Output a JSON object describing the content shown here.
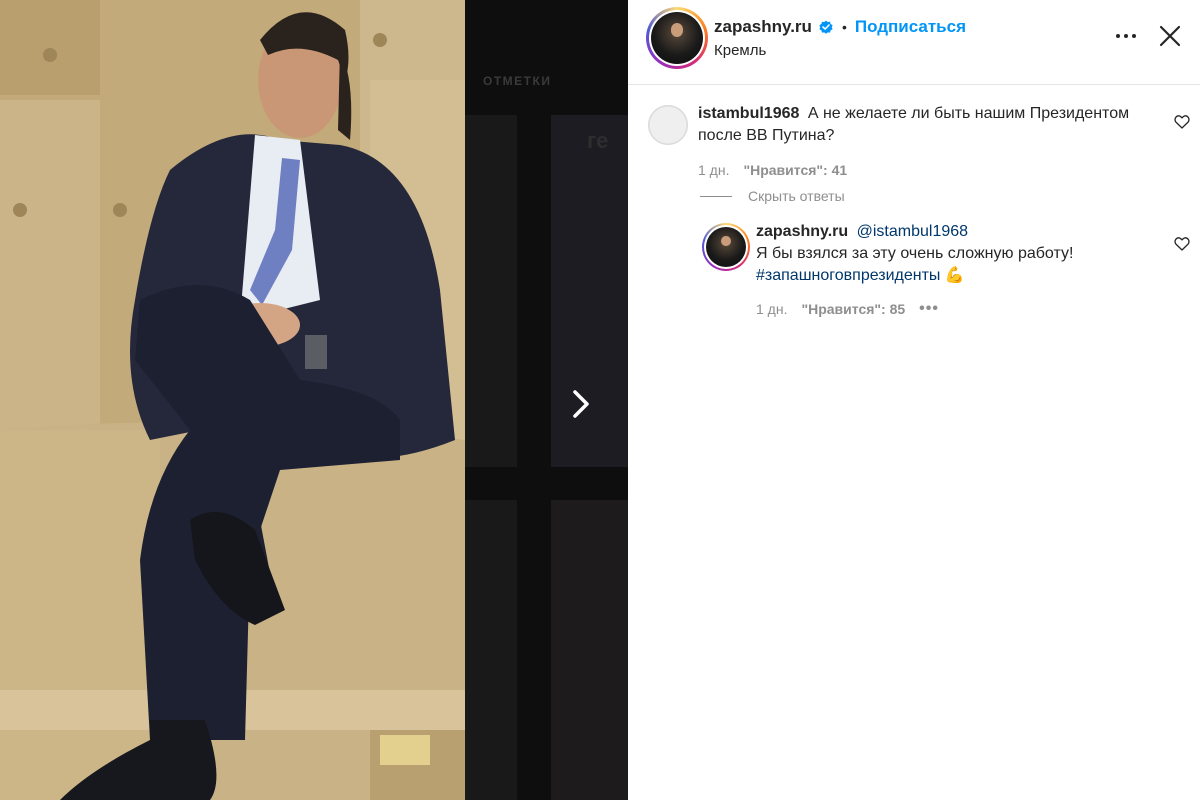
{
  "header": {
    "username": "zapashny.ru",
    "separator": "•",
    "follow_label": "Подписаться",
    "location": "Кремль",
    "verified_color": "#0095f6",
    "follow_color": "#0095f6"
  },
  "backdrop": {
    "tab_label": "ОТМЕТКИ",
    "tile_text": "ге"
  },
  "comments": [
    {
      "username": "istambul1968",
      "text_line1": "А не желаете ли быть нашим Президентом",
      "text_line2": "после ВВ Путина?",
      "age": "1 дн.",
      "likes": "\"Нравится\": 41"
    }
  ],
  "hide_replies_label": "Скрыть ответы",
  "reply": {
    "username": "zapashny.ru",
    "mention": "@istambul1968",
    "text": "Я бы взялся за эту очень сложную работу!",
    "hashtag": "#запашноговпрезиденты",
    "emoji": "💪",
    "age": "1 дн.",
    "likes": "\"Нравится\": 85",
    "more": "•••"
  },
  "icons": {
    "next": "chevron-right-icon",
    "more": "more-horizontal-icon",
    "close": "close-icon",
    "like": "heart-outline-icon",
    "verified": "verified-badge-icon"
  }
}
